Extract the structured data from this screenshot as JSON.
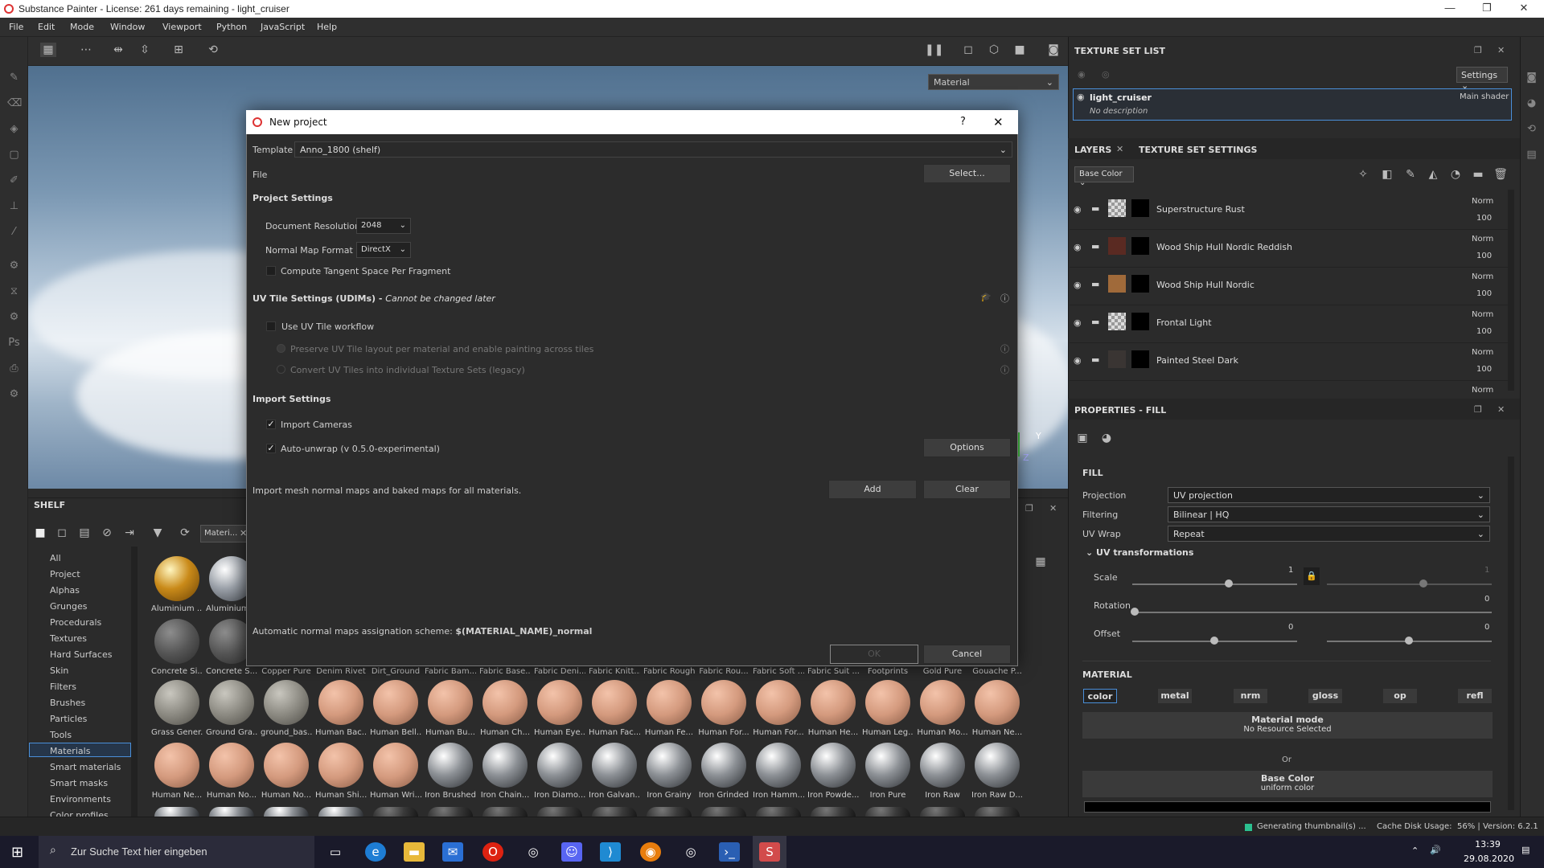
{
  "window": {
    "title": "Substance Painter - License: 261 days remaining - light_cruiser",
    "minimize": "—",
    "maximize": "❐",
    "close": "✕"
  },
  "menu": [
    "File",
    "Edit",
    "Mode",
    "Window",
    "Viewport",
    "Python",
    "JavaScript",
    "Help"
  ],
  "viewport": {
    "mode": "Material",
    "axis_y": "Y",
    "axis_z": "Z"
  },
  "shelf": {
    "title": "SHELF",
    "filter_tag": "Materi...",
    "categories": [
      "All",
      "Project",
      "Alphas",
      "Grunges",
      "Procedurals",
      "Textures",
      "Hard Surfaces",
      "Skin",
      "Filters",
      "Brushes",
      "Particles",
      "Tools",
      "Materials",
      "Smart materials",
      "Smart masks",
      "Environments",
      "Color profiles"
    ],
    "selected_category": "Materials",
    "row1": [
      "Aluminium ...",
      "Aluminium ..."
    ],
    "row2": [
      "Concrete Si...",
      "Concrete S...",
      "Copper Pure",
      "Denim Rivet",
      "Dirt_Ground",
      "Fabric Bam...",
      "Fabric Base...",
      "Fabric Deni...",
      "Fabric Knitt...",
      "Fabric Rough",
      "Fabric Rou...",
      "Fabric Soft ...",
      "Fabric Suit ...",
      "Footprints",
      "Gold Pure",
      "Gouache P..."
    ],
    "row3": [
      "Grass Gener...",
      "Ground Gra...",
      "ground_bas...",
      "Human Bac...",
      "Human Bell...",
      "Human Bu...",
      "Human Ch...",
      "Human Eye...",
      "Human Fac...",
      "Human Fe...",
      "Human For...",
      "Human For...",
      "Human He...",
      "Human Leg...",
      "Human Mo...",
      "Human Ne..."
    ],
    "row4": [
      "Human Ne...",
      "Human No...",
      "Human No...",
      "Human Shi...",
      "Human Wri...",
      "Iron Brushed",
      "Iron Chain...",
      "Iron Diamo...",
      "Iron Galvan...",
      "Iron Grainy",
      "Iron Grinded",
      "Iron Hamm...",
      "Iron Powde...",
      "Iron Pure",
      "Iron Raw",
      "Iron Raw D..."
    ]
  },
  "texture_set_list": {
    "title": "TEXTURE SET LIST",
    "settings": "Settings",
    "item_name": "light_cruiser",
    "item_desc": "No description",
    "shader": "Main shader"
  },
  "layers": {
    "tab1": "LAYERS",
    "tab2": "TEXTURE SET SETTINGS",
    "channel": "Base Color",
    "items": [
      {
        "name": "Superstructure Rust",
        "blend": "Norm",
        "opacity": "100"
      },
      {
        "name": "Wood Ship Hull Nordic Reddish",
        "blend": "Norm",
        "opacity": "100"
      },
      {
        "name": "Wood Ship Hull Nordic",
        "blend": "Norm",
        "opacity": "100"
      },
      {
        "name": "Frontal Light",
        "blend": "Norm",
        "opacity": "100"
      },
      {
        "name": "Painted Steel Dark",
        "blend": "Norm",
        "opacity": "100"
      }
    ],
    "partial_blend": "Norm"
  },
  "properties": {
    "title": "PROPERTIES - FILL",
    "section": "FILL",
    "projection_label": "Projection",
    "projection": "UV projection",
    "filtering_label": "Filtering",
    "filtering": "Bilinear | HQ",
    "uvwrap_label": "UV Wrap",
    "uvwrap": "Repeat",
    "uvtrans": "UV transformations",
    "scale_label": "Scale",
    "scale_val": "1",
    "scale_val2": "1",
    "rotation_label": "Rotation",
    "rotation_val": "0",
    "offset_label": "Offset",
    "offset_val1": "0",
    "offset_val2": "0",
    "material_section": "MATERIAL",
    "mat_buttons": [
      "color",
      "metal",
      "nrm",
      "gloss",
      "op",
      "refl"
    ],
    "material_mode": "Material mode",
    "no_resource": "No Resource Selected",
    "or": "Or",
    "base_color": "Base Color",
    "uniform": "uniform color"
  },
  "dialog": {
    "title": "New project",
    "help": "?",
    "close": "✕",
    "template_label": "Template",
    "template": "Anno_1800 (shelf)",
    "file_label": "File",
    "select_btn": "Select...",
    "project_settings": "Project Settings",
    "doc_res_label": "Document Resolution",
    "doc_res": "2048",
    "normal_fmt_label": "Normal Map Format",
    "normal_fmt": "DirectX",
    "tangent": "Compute Tangent Space Per Fragment",
    "udim_title": "UV Tile Settings (UDIMs) - ",
    "udim_note": "Cannot be changed later",
    "use_uv_tile": "Use UV Tile workflow",
    "preserve": "Preserve UV Tile layout per material and enable painting across tiles",
    "convert": "Convert UV Tiles into individual Texture Sets (legacy)",
    "import_settings": "Import Settings",
    "import_cameras": "Import Cameras",
    "auto_unwrap": "Auto-unwrap (v 0.5.0-experimental)",
    "options_btn": "Options",
    "import_maps": "Import mesh normal maps and baked maps for all materials.",
    "add_btn": "Add",
    "clear_btn": "Clear",
    "scheme_label": "Automatic normal maps assignation scheme: ",
    "scheme": "$(MATERIAL_NAME)_normal",
    "ok_btn": "OK",
    "cancel_btn": "Cancel"
  },
  "status": {
    "generating": "Generating thumbnail(s) ...",
    "cache": "Cache Disk Usage:",
    "usage": "56% | Version: 6.2.1"
  },
  "taskbar": {
    "search_placeholder": "Zur Suche Text hier eingeben",
    "time": "13:39",
    "date": "29.08.2020"
  }
}
